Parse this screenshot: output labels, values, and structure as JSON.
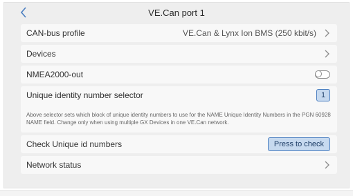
{
  "header": {
    "title": "VE.Can port 1",
    "back_icon": "chevron-left-icon"
  },
  "rows": {
    "can_bus_profile": {
      "label": "CAN-bus profile",
      "value": "VE.Can & Lynx Ion BMS (250 kbit/s)"
    },
    "devices": {
      "label": "Devices"
    },
    "nmea_out": {
      "label": "NMEA2000-out",
      "state": "off"
    },
    "unique_selector": {
      "label": "Unique identity number selector",
      "value": "1",
      "description": "Above selector sets which block of unique identity numbers to use for the NAME Unique Identity Numbers in the PGN 60928 NAME field. Change only when using multiple GX Devices in one VE.Can network."
    },
    "check_unique": {
      "label": "Check Unique id numbers",
      "button": "Press to check"
    },
    "network_status": {
      "label": "Network status"
    }
  },
  "colors": {
    "accent": "#4a7ec0",
    "button_fill": "#c6d9ef",
    "background": "#eeeeee",
    "row": "#f8f8f8"
  }
}
